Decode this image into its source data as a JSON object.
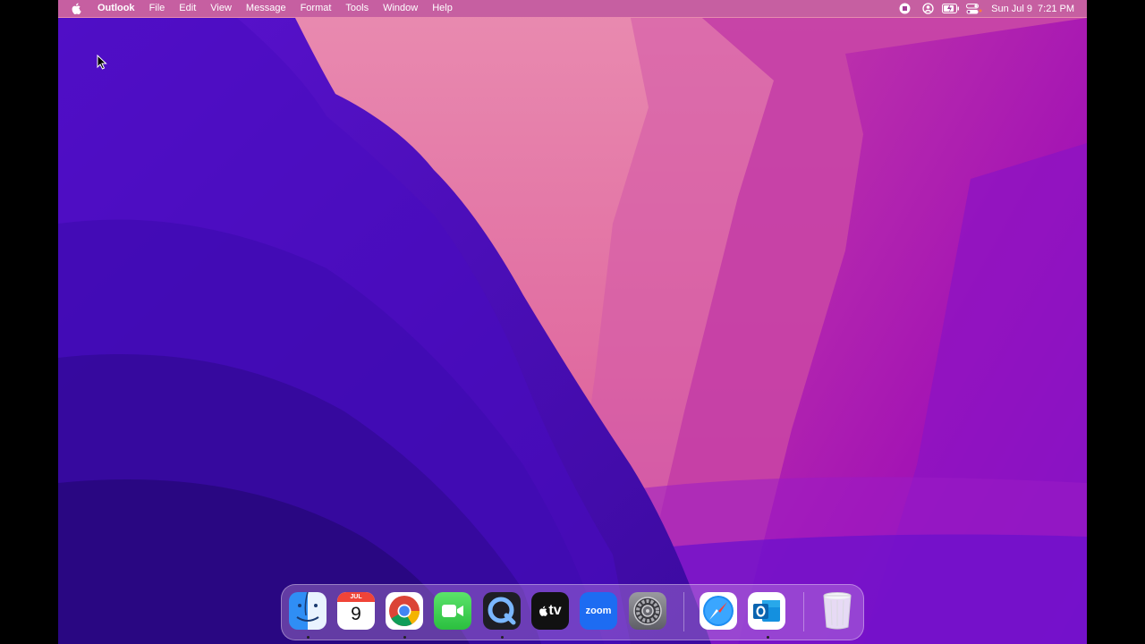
{
  "menubar": {
    "app_name": "Outlook",
    "menus": [
      "File",
      "Edit",
      "View",
      "Message",
      "Format",
      "Tools",
      "Window",
      "Help"
    ],
    "status_icons": [
      "screen-record-icon",
      "user-icon",
      "battery-charging-icon",
      "control-center-icon"
    ],
    "clock": {
      "day_date": "Sun Jul 9",
      "time": "7:21 PM"
    }
  },
  "dock": {
    "apps": [
      {
        "name": "Finder",
        "icon": "finder-icon",
        "running": true
      },
      {
        "name": "Calendar",
        "icon": "calendar-icon",
        "running": false,
        "month": "JUL",
        "day": "9"
      },
      {
        "name": "Google Chrome",
        "icon": "chrome-icon",
        "running": true
      },
      {
        "name": "FaceTime",
        "icon": "facetime-icon",
        "running": false
      },
      {
        "name": "QuickTime Player",
        "icon": "quicktime-icon",
        "running": true
      },
      {
        "name": "Apple TV",
        "icon": "appletv-icon",
        "running": false,
        "label": "tv"
      },
      {
        "name": "zoom.us",
        "icon": "zoom-icon",
        "running": false,
        "label": "zoom"
      },
      {
        "name": "System Preferences",
        "icon": "settings-gear-icon",
        "running": false
      },
      {
        "name": "Safari",
        "icon": "safari-compass-icon",
        "running": false
      },
      {
        "name": "Microsoft Outlook",
        "icon": "outlook-icon",
        "running": true
      },
      {
        "name": "Trash",
        "icon": "trash-icon",
        "running": false
      }
    ]
  },
  "colors": {
    "wallpaper_deep": "#3a0aa8",
    "wallpaper_violet": "#6a10d0",
    "wallpaper_magenta": "#c22fb4",
    "wallpaper_pink": "#e47aa8"
  }
}
